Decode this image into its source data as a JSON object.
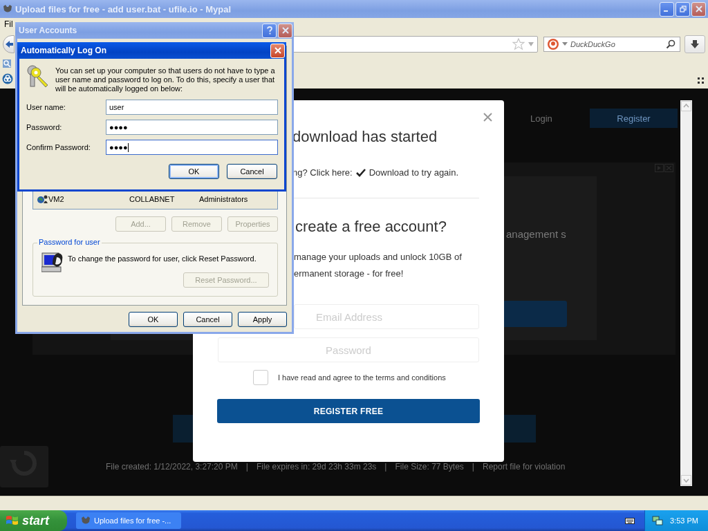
{
  "browser": {
    "title": "Upload files for free - add user.bat - ufile.io - Mypal",
    "active": false,
    "menu": [
      "Fil"
    ],
    "search_placeholder": "DuckDuckGo"
  },
  "page": {
    "login": "Login",
    "register": "Register",
    "ad_text": "anagement s",
    "footer": [
      "File created: 1/12/2022, 3:27:20 PM",
      "File expires in: 29d 23h 33m 23s",
      "File Size: 77 Bytes",
      "Report file for violation"
    ],
    "footer_separator": "|"
  },
  "modal": {
    "heading": "download has started",
    "retry_text": "ng? Click here:",
    "retry_link": "Download to try again.",
    "account_heading": "create a free account?",
    "pitch_lines": [
      "manage your uploads and unlock 10GB of",
      "ermanent storage - for free!"
    ],
    "email_placeholder": "Email Address",
    "password_placeholder": "Password",
    "terms": {
      "label": "I have read and agree to the terms and conditions",
      "checked": false
    },
    "register_button": "REGISTER FREE"
  },
  "user_accounts": {
    "title": "User Accounts",
    "active": false,
    "users": [
      {
        "name": "VM2",
        "domain": "COLLABNET",
        "group": "Administrators"
      }
    ],
    "user_buttons": [
      {
        "label": "Add...",
        "disabled": true
      },
      {
        "label": "Remove",
        "disabled": true
      },
      {
        "label": "Properties",
        "disabled": true
      }
    ],
    "password_group": {
      "title": "Password for user",
      "text": "To change the password for user, click Reset Password.",
      "button": {
        "label": "Reset Password...",
        "disabled": true
      }
    },
    "buttons": [
      {
        "label": "OK",
        "disabled": false
      },
      {
        "label": "Cancel",
        "disabled": false
      },
      {
        "label": "Apply",
        "disabled": false
      }
    ]
  },
  "auto_logon": {
    "title": "Automatically Log On",
    "active": true,
    "text": "You can set up your computer so that users do not have to type a user name and password to log on. To do this, specify a user that will be automatically logged on below:",
    "fields": [
      {
        "label": "User name:",
        "value": "user",
        "focused": false
      },
      {
        "label": "Password:",
        "value": "●●●●",
        "focused": false
      },
      {
        "label": "Confirm Password:",
        "value": "●●●●",
        "focused": true
      }
    ],
    "buttons": [
      {
        "label": "OK",
        "default": true
      },
      {
        "label": "Cancel",
        "default": false
      }
    ]
  },
  "taskbar": {
    "start": "start",
    "tasks": [
      {
        "label": "Upload files for free -...",
        "selected": false
      }
    ],
    "clock": "3:53 PM"
  }
}
